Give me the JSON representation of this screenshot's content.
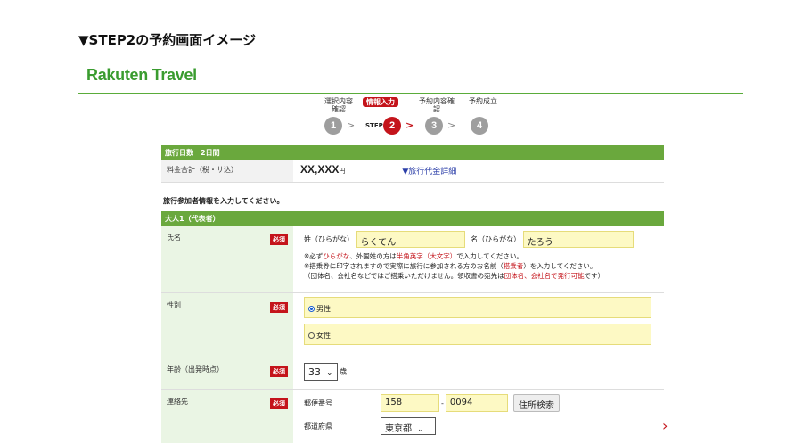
{
  "heading": "▼STEP2の予約画面イメージ",
  "logo": "Rakuten Travel",
  "steps": {
    "labels": [
      "選択内容\n確認",
      "情報入力",
      "予約内容確\n認",
      "予約成立"
    ],
    "numbers": [
      "1",
      "2",
      "3",
      "4"
    ],
    "step_tag": "STEP",
    "arrow": ">"
  },
  "trip": {
    "bar": "旅行日数　2日間",
    "fee_label": "料金合計（税・サ込）",
    "fee_amount": "XX,XXX",
    "fee_unit": "円",
    "fee_link": "▼旅行代金詳細"
  },
  "instruction": "旅行参加者情報を入力してください。",
  "adult_bar": "大人1（代表者）",
  "required": "必須",
  "name": {
    "label": "氏名",
    "sei_label": "姓（ひらがな）",
    "sei_value": "らくてん",
    "mei_label": "名（ひらがな）",
    "mei_value": "たろう",
    "note1_a": "※必ず",
    "note1_b": "ひらがな",
    "note1_c": "、外国姓の方は",
    "note1_d": "半角英字（大文字）",
    "note1_e": "で入力してください。",
    "note2_a": "※搭乗券に印字されますので実際に旅行に参加される方のお名前（",
    "note2_b": "搭乗者",
    "note2_c": "）を入力してください。",
    "note3_a": "（団体名、会社名などではご搭乗いただけません。領収書の宛先は",
    "note3_b": "団体名、会社名で発行可能",
    "note3_c": "です）"
  },
  "gender": {
    "label": "性別",
    "male": "男性",
    "female": "女性"
  },
  "age": {
    "label": "年齢（出発時点）",
    "value": "33",
    "unit": "歳"
  },
  "contact": {
    "label": "連絡先",
    "zip_label": "郵便番号",
    "zip1": "158",
    "zip_sep": "-",
    "zip2": "0094",
    "zip_button": "住所検索",
    "pref_label": "都道府県",
    "pref_value": "東京都"
  }
}
